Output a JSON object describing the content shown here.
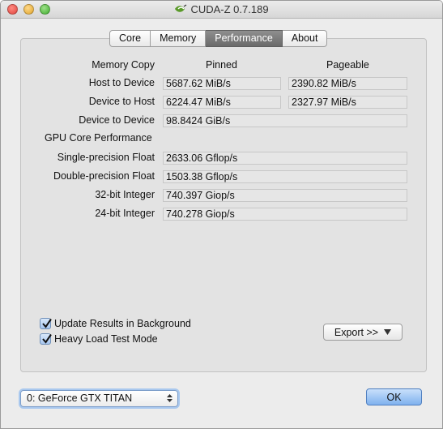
{
  "window": {
    "title": "CUDA-Z 0.7.189"
  },
  "tabs": [
    {
      "label": "Core",
      "active": false
    },
    {
      "label": "Memory",
      "active": false
    },
    {
      "label": "Performance",
      "active": true
    },
    {
      "label": "About",
      "active": false
    }
  ],
  "memory_copy": {
    "section_label": "Memory Copy",
    "col_pinned": "Pinned",
    "col_pageable": "Pageable",
    "rows": [
      {
        "label": "Host to Device",
        "pinned": "5687.62 MiB/s",
        "pageable": "2390.82 MiB/s"
      },
      {
        "label": "Device to Host",
        "pinned": "6224.47 MiB/s",
        "pageable": "2327.97 MiB/s"
      },
      {
        "label": "Device to Device",
        "value": "98.8424 GiB/s"
      }
    ]
  },
  "gpu_core": {
    "section_label": "GPU Core Performance",
    "rows": [
      {
        "label": "Single-precision Float",
        "value": "2633.06 Gflop/s"
      },
      {
        "label": "Double-precision Float",
        "value": "1503.38 Gflop/s"
      },
      {
        "label": "32-bit Integer",
        "value": "740.397 Giop/s"
      },
      {
        "label": "24-bit Integer",
        "value": "740.278 Giop/s"
      }
    ]
  },
  "options": {
    "update_background": {
      "label": "Update Results in Background",
      "checked": true
    },
    "heavy_load": {
      "label": "Heavy Load Test Mode",
      "checked": true
    }
  },
  "export_button": {
    "label": "Export >>"
  },
  "device_select": {
    "value": "0: GeForce GTX TITAN"
  },
  "ok_button": {
    "label": "OK"
  },
  "colors": {
    "accent": "#7fb1ee",
    "active_tab": "#777777"
  }
}
